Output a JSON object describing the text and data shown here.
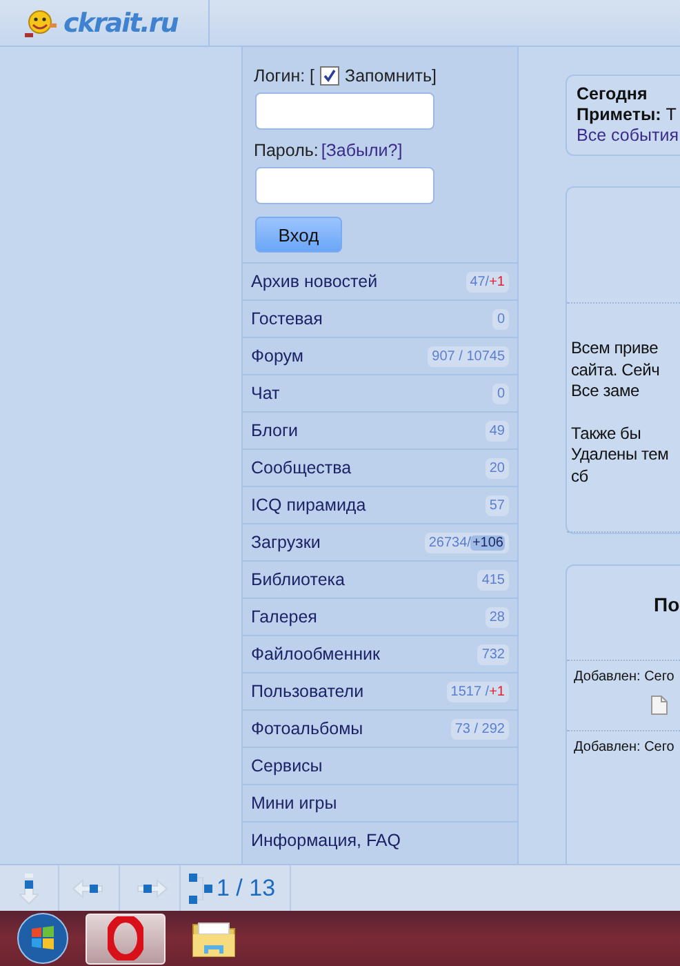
{
  "header": {
    "logo_text": "ckrait.ru"
  },
  "login": {
    "login_label": "Логин: [",
    "remember": {
      "label": "Запомнить]",
      "checked": true
    },
    "password_label": "Пароль:",
    "forgot_link": "[Забыли?]",
    "submit": "Вход"
  },
  "nav": [
    {
      "label": "Архив новостей",
      "badge": [
        {
          "text": "47/",
          "kind": "count"
        },
        {
          "text": "+1",
          "kind": "new"
        }
      ]
    },
    {
      "label": "Гостевая",
      "badge": [
        {
          "text": "0",
          "kind": "count"
        }
      ]
    },
    {
      "label": "Форум",
      "badge": [
        {
          "text": "907 / 10745",
          "kind": "count"
        }
      ]
    },
    {
      "label": "Чат",
      "badge": [
        {
          "text": "0",
          "kind": "count"
        }
      ]
    },
    {
      "label": "Блоги",
      "badge": [
        {
          "text": "49",
          "kind": "count"
        }
      ]
    },
    {
      "label": "Сообщества",
      "badge": [
        {
          "text": "20",
          "kind": "count"
        }
      ]
    },
    {
      "label": "ICQ пирамида",
      "badge": [
        {
          "text": "57",
          "kind": "count"
        }
      ]
    },
    {
      "label": "Загрузки",
      "badge": [
        {
          "text": "26734/",
          "kind": "count"
        },
        {
          "text": "+106",
          "kind": "highlight"
        }
      ]
    },
    {
      "label": "Библиотека",
      "badge": [
        {
          "text": "415",
          "kind": "count"
        }
      ]
    },
    {
      "label": "Галерея",
      "badge": [
        {
          "text": "28",
          "kind": "count"
        }
      ]
    },
    {
      "label": "Файлообменник",
      "badge": [
        {
          "text": "732",
          "kind": "count"
        }
      ]
    },
    {
      "label": "Пользователи",
      "badge": [
        {
          "text": "1517 / ",
          "kind": "count"
        },
        {
          "text": "+1",
          "kind": "new"
        }
      ]
    },
    {
      "label": "Фотоальбомы",
      "badge": [
        {
          "text": "73 / 292",
          "kind": "count"
        }
      ]
    },
    {
      "label": "Сервисы"
    },
    {
      "label": "Мини игры"
    },
    {
      "label": "Информация, FAQ"
    }
  ],
  "today_card": {
    "title": "Сегодня",
    "omens": "**Приметы:** Т",
    "all_events_link": "Все события"
  },
  "news_card": {
    "paragraphs": [
      "Всем приве\nсайта. Сейч\nВсе заме",
      "Также бы\nУдалены тем\nсб"
    ]
  },
  "files_card": {
    "title": "По",
    "entries": [
      "Добавлен: Сего",
      "Добавлен: Сего"
    ]
  },
  "toolbar": {
    "page_counter": "1 / 13"
  },
  "taskbar": [
    {
      "kind": "start",
      "selected": false
    },
    {
      "kind": "opera",
      "selected": true
    },
    {
      "kind": "folder",
      "selected": false
    }
  ]
}
